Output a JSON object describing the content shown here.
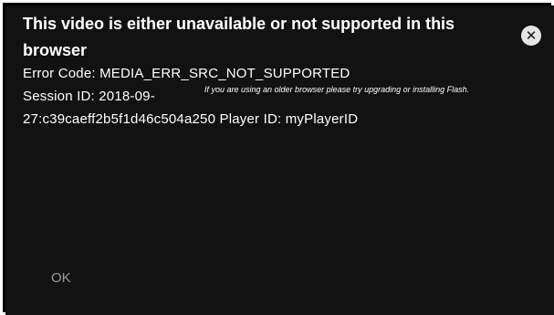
{
  "error_dialog": {
    "title": "This video is either unavailable or not supported in this browser",
    "error_code_line": "Error Code: MEDIA_ERR_SRC_NOT_SUPPORTED",
    "session_line_1": "Session ID: 2018-09-",
    "session_line_2": "27:c39caeff2b5f1d46c504a250 Player ID: myPlayerID",
    "hint": "If you are using an older browser please try upgrading or installing Flash.",
    "ok_label": "OK",
    "close_icon": "close-icon"
  },
  "colors": {
    "background": "#121212",
    "frame": "#000000",
    "text": "#ffffff",
    "ok_text": "#9a9a9a",
    "close_icon_bg": "#e6e6e6"
  }
}
